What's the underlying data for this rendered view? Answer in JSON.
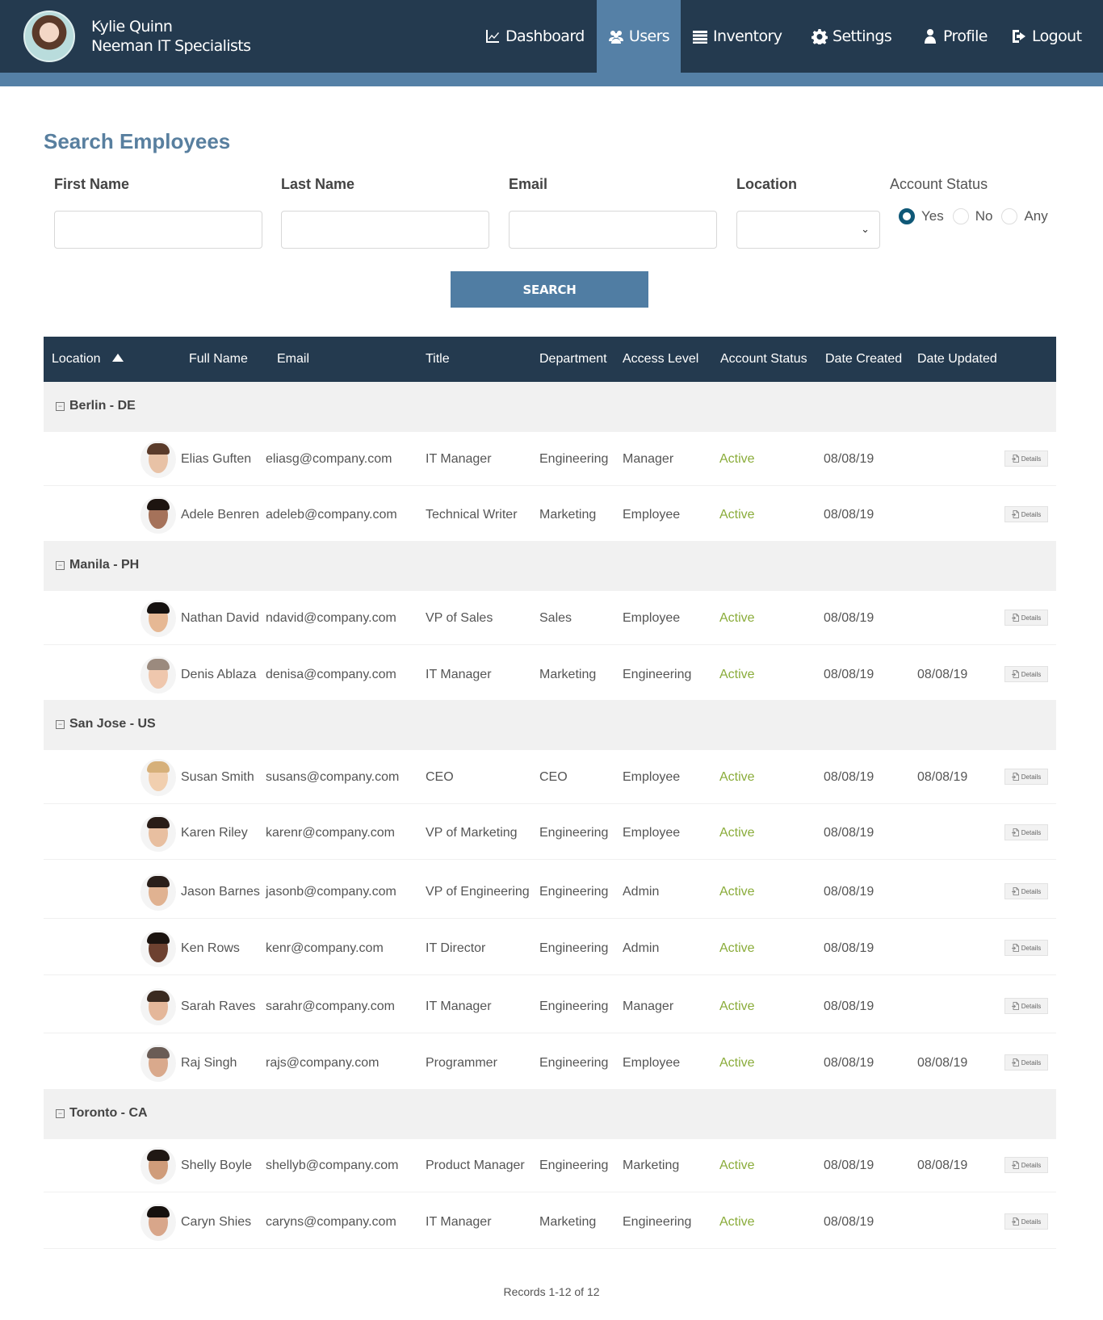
{
  "header": {
    "user_name": "Kylie Quinn",
    "company": "Neeman IT Specialists",
    "nav": [
      {
        "label": "Dashboard",
        "icon": "chart-line-icon",
        "active": false
      },
      {
        "label": "Users",
        "icon": "users-icon",
        "active": true
      },
      {
        "label": "Inventory",
        "icon": "list-icon",
        "active": false
      },
      {
        "label": "Settings",
        "icon": "gear-icon",
        "active": false
      },
      {
        "label": "Profile",
        "icon": "user-icon",
        "active": false
      },
      {
        "label": "Logout",
        "icon": "sign-out-icon",
        "active": false
      }
    ]
  },
  "search": {
    "title": "Search Employees",
    "first_name_label": "First Name",
    "first_name_value": "",
    "last_name_label": "Last Name",
    "last_name_value": "",
    "email_label": "Email",
    "email_value": "",
    "location_label": "Location",
    "location_value": "",
    "account_status_label": "Account Status",
    "account_status_options": [
      "Yes",
      "No",
      "Any"
    ],
    "account_status_selected": "Yes",
    "search_button": "SEARCH"
  },
  "table": {
    "columns": [
      "Location",
      "Full Name",
      "Email",
      "Title",
      "Department",
      "Access Level",
      "Account Status",
      "Date Created",
      "Date Updated"
    ],
    "sort_column": "Location",
    "sort_direction": "ascending",
    "details_label": "Details",
    "groups": [
      {
        "name": "Berlin - DE",
        "rows": [
          {
            "name": "Elias Guften",
            "email": "eliasg@company.com",
            "title": "IT Manager",
            "department": "Engineering",
            "access": "Manager",
            "status": "Active",
            "created": "08/08/19",
            "updated": ""
          },
          {
            "name": "Adele Benren",
            "email": "adeleb@company.com",
            "title": "Technical Writer",
            "department": "Marketing",
            "access": "Employee",
            "status": "Active",
            "created": "08/08/19",
            "updated": ""
          }
        ]
      },
      {
        "name": "Manila - PH",
        "rows": [
          {
            "name": "Nathan David",
            "email": "ndavid@company.com",
            "title": "VP of Sales",
            "department": "Sales",
            "access": "Employee",
            "status": "Active",
            "created": "08/08/19",
            "updated": ""
          },
          {
            "name": "Denis Ablaza",
            "email": "denisa@company.com",
            "title": "IT Manager",
            "department": "Marketing",
            "access": "Engineering",
            "status": "Active",
            "created": "08/08/19",
            "updated": "08/08/19"
          }
        ]
      },
      {
        "name": "San Jose - US",
        "rows": [
          {
            "name": "Susan Smith",
            "email": "susans@company.com",
            "title": "CEO",
            "department": "CEO",
            "access": "Employee",
            "status": "Active",
            "created": "08/08/19",
            "updated": "08/08/19"
          },
          {
            "name": "Karen Riley",
            "email": "karenr@company.com",
            "title": "VP of Marketing",
            "department": "Engineering",
            "access": "Employee",
            "status": "Active",
            "created": "08/08/19",
            "updated": ""
          },
          {
            "name": "Jason Barnes",
            "email": "jasonb@company.com",
            "title": "VP of Engineering",
            "department": "Engineering",
            "access": "Admin",
            "status": "Active",
            "created": "08/08/19",
            "updated": ""
          },
          {
            "name": "Ken Rows",
            "email": "kenr@company.com",
            "title": "IT Director",
            "department": "Engineering",
            "access": "Admin",
            "status": "Active",
            "created": "08/08/19",
            "updated": ""
          },
          {
            "name": "Sarah Raves",
            "email": "sarahr@company.com",
            "title": "IT Manager",
            "department": "Engineering",
            "access": "Manager",
            "status": "Active",
            "created": "08/08/19",
            "updated": ""
          },
          {
            "name": "Raj Singh",
            "email": "rajs@company.com",
            "title": "Programmer",
            "department": "Engineering",
            "access": "Employee",
            "status": "Active",
            "created": "08/08/19",
            "updated": "08/08/19"
          }
        ]
      },
      {
        "name": "Toronto - CA",
        "rows": [
          {
            "name": "Shelly Boyle",
            "email": "shellyb@company.com",
            "title": "Product Manager",
            "department": "Engineering",
            "access": "Marketing",
            "status": "Active",
            "created": "08/08/19",
            "updated": "08/08/19"
          },
          {
            "name": "Caryn Shies",
            "email": "caryns@company.com",
            "title": "IT Manager",
            "department": "Marketing",
            "access": "Engineering",
            "status": "Active",
            "created": "08/08/19",
            "updated": ""
          }
        ]
      }
    ]
  },
  "footer": {
    "records": "Records 1-12 of 12"
  },
  "colors": {
    "header_bg": "#243a4f",
    "accent": "#5580a6",
    "title": "#587f9f",
    "status_active": "#8aac3a",
    "radio_checked": "#0f5877"
  }
}
